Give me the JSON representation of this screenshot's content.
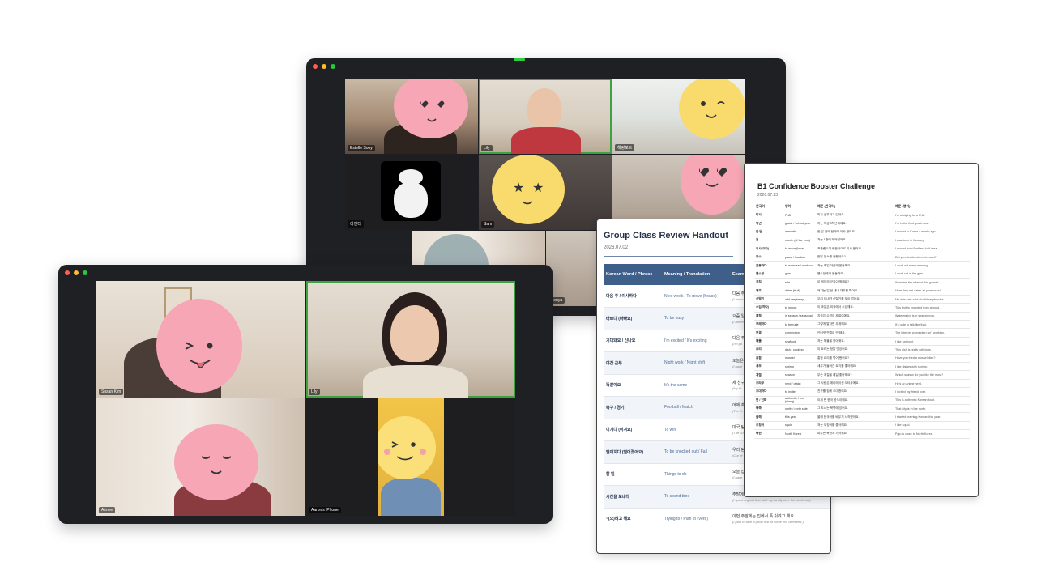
{
  "call_back": {
    "participants": [
      {
        "name": "Estelle Sooy"
      },
      {
        "name": "Lily"
      },
      {
        "name": "해랑포드"
      },
      {
        "name": "리앤디"
      },
      {
        "name": "Sam"
      },
      {
        "name": "Kenya"
      }
    ]
  },
  "call_front": {
    "participants": [
      {
        "name": "Susan Kim"
      },
      {
        "name": "Lily"
      },
      {
        "name": "Aimee"
      },
      {
        "name": "Aaron's iPhone"
      }
    ]
  },
  "handout": {
    "title": "Group Class Review Handout",
    "date": "2026.07.02",
    "headers": [
      "Korean Word / Phrase",
      "Meaning / Translation",
      "Exam"
    ],
    "rows": [
      {
        "word": "다음 주 / 이사하다",
        "meaning": "Next week / To move (house)",
        "example": "다음 주",
        "translation": "(I am m"
      },
      {
        "word": "바쁘다 (바빠요)",
        "meaning": "To be busy",
        "example": "요즘 일",
        "translation": "(I am re work.)"
      },
      {
        "word": "기대돼요 / 신나요",
        "meaning": "I'm excited / It's exciting",
        "example": "다음 주",
        "translation": "(I'm go"
      },
      {
        "word": "야간 근무",
        "meaning": "Night work / Night shift",
        "example": "오늘은",
        "translation": "(I have"
      },
      {
        "word": "똑같아요",
        "meaning": "It's the same",
        "example": "제 친구",
        "translation": "(My fri"
      },
      {
        "word": "축구 / 경기",
        "meaning": "Football / Match",
        "example": "어제 축",
        "translation": "(The fo"
      },
      {
        "word": "이기다 (이겨요)",
        "meaning": "To win",
        "example": "미국 팀",
        "translation": "(The US"
      },
      {
        "word": "떨어지다 (떨어졌어요)",
        "meaning": "To be knocked out / Fail",
        "example": "우리 팀",
        "translation": "(Our te"
      },
      {
        "word": "할 일",
        "meaning": "Things to do",
        "example": "오늘 집",
        "translation": "(I have"
      },
      {
        "word": "시간을 보내다",
        "meaning": "To spend time",
        "example": "주말에 가족들과 즐거운 시간을 보냈어요.",
        "translation": "(I spent a good time with my family over the weekend.)"
      },
      {
        "word": "~(으)려고 해요",
        "meaning": "Trying to / Plan to (Verb)",
        "example": "이번 주말에는 집에서 푹 쉬려고 해요.",
        "translation": "(I plan to take a good rest at home this weekend.)"
      }
    ]
  },
  "challenge": {
    "title": "B1 Confidence Booster Challenge",
    "date": "2026.07.23",
    "headers": [
      "한국어",
      "영어",
      "예문 (한국어)",
      "예문 (영어)"
    ],
    "rows": [
      {
        "ko": "박사",
        "en": "PhD",
        "ex_ko": "박사 공부하고 있어요.",
        "ex_en": "I'm studying for a PhD."
      },
      {
        "ko": "학년",
        "en": "grade / school year",
        "ex_ko": "저는 지금 3학년이에요.",
        "ex_en": "I'm in the third grade now."
      },
      {
        "ko": "한 달",
        "en": "a month",
        "ex_ko": "한 달 전에 한국에 이사 왔어요.",
        "ex_en": "I moved to Korea a month ago."
      },
      {
        "ko": "월",
        "en": "month (of the year)",
        "ex_ko": "저는 1월에 태어났어요.",
        "ex_en": "I was born in January."
      },
      {
        "ko": "이사(오다)",
        "en": "to move (here)",
        "ex_ko": "포틀랜드에서 한국으로 이사 왔어요.",
        "ex_en": "I moved from Portland to Korea."
      },
      {
        "ko": "장소",
        "en": "place / location",
        "ex_ko": "만날 장소를 정했어요?",
        "ex_en": "Did you decide where to meet?"
      },
      {
        "ko": "운동하다",
        "en": "to exercise / work out",
        "ex_ko": "저는 매일 아침에 운동해요.",
        "ex_en": "I work out every morning."
      },
      {
        "ko": "헬스장",
        "en": "gym",
        "ex_ko": "헬스장에서 운동해요.",
        "ex_en": "I work out at the gym."
      },
      {
        "ko": "규칙",
        "en": "rule",
        "ex_ko": "이 게임의 규칙이 뭐예요?",
        "ex_en": "What are the rules of this game?"
      },
      {
        "ko": "대추",
        "en": "dates (fruit)",
        "ex_ko": "여기는 일 년 내내 대추를 먹어요.",
        "ex_en": "Here they eat dates all year round."
      },
      {
        "ko": "산딸기",
        "en": "wild raspberry",
        "ex_ko": "우리 아내가 산딸기를 많이 먹어요.",
        "ex_en": "My wife eats a lot of wild raspberries."
      },
      {
        "ko": "수입(하다)",
        "en": "to import",
        "ex_ko": "이 과일은 외국에서 수입해요.",
        "ex_en": "This fruit is imported from abroad."
      },
      {
        "ko": "제철",
        "en": "in season / seasonal",
        "ex_ko": "지금은 수박이 제철이에요.",
        "ex_en": "Watermelon is in season now."
      },
      {
        "ko": "무례하다",
        "en": "to be rude",
        "ex_ko": "그렇게 말하면 무례해요.",
        "ex_en": "It's rude to talk like that."
      },
      {
        "ko": "연결",
        "en": "connection",
        "ex_ko": "인터넷 연결이 안 돼요.",
        "ex_en": "The internet connection isn't working."
      },
      {
        "ko": "해물",
        "en": "seafood",
        "ex_ko": "저는 해물을 좋아해요.",
        "ex_en": "I like seafood."
      },
      {
        "ko": "요리",
        "en": "dish / cooking",
        "ex_ko": "이 요리는 정말 맛있어요.",
        "ex_en": "This dish is really delicious."
      },
      {
        "ko": "홍합",
        "en": "mussel",
        "ex_ko": "홍합 요리를 먹어 봤어요?",
        "ex_en": "Have you tried a mussel dish?"
      },
      {
        "ko": "새우",
        "en": "shrimp",
        "ex_ko": "새우가 들어간 요리를 좋아해요.",
        "ex_en": "I like dishes with shrimp."
      },
      {
        "ko": "계절",
        "en": "season",
        "ex_ko": "무슨 계절을 제일 좋아해요?",
        "ex_en": "Which season do you like the most?"
      },
      {
        "ko": "오타쿠",
        "en": "nerd / otaku",
        "ex_ko": "그 사람은 애니메이션 오타쿠예요.",
        "ex_en": "He's an anime nerd."
      },
      {
        "ko": "초대하다",
        "en": "to invite",
        "ex_ko": "친구를 집에 초대했어요.",
        "ex_en": "I invited my friend over."
      },
      {
        "ko": "찐 / 진짜",
        "en": "authentic / real (slang)",
        "ex_ko": "이게 찐 한국 음식이에요.",
        "ex_en": "This is authentic Korean food."
      },
      {
        "ko": "북쪽",
        "en": "north / north side",
        "ex_ko": "그 도시는 북쪽에 있어요.",
        "ex_en": "That city is in the north."
      },
      {
        "ko": "올해",
        "en": "this year",
        "ex_ko": "올해 한국어를 배우기 시작했어요.",
        "ex_en": "I started learning Korean this year."
      },
      {
        "ko": "오징어",
        "en": "squid",
        "ex_ko": "저는 오징어를 좋아해요.",
        "ex_en": "I like squid."
      },
      {
        "ko": "북한",
        "en": "North Korea",
        "ex_ko": "파주는 북한과 가까워요.",
        "ex_en": "Paju is close to North Korea."
      }
    ]
  },
  "colors": {
    "active_speaker": "#3fa142",
    "emoji_pink": "#f7a6b5",
    "emoji_yellow": "#f9db6d",
    "handout_header": "#3e5f8a"
  }
}
